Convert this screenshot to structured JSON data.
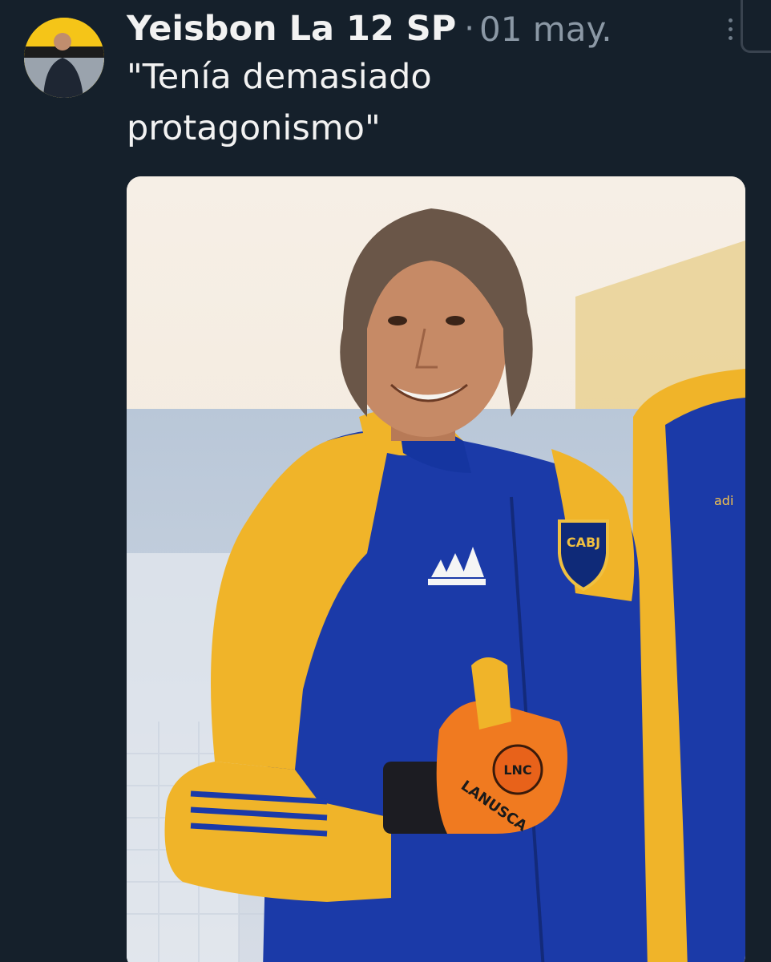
{
  "tweet": {
    "display_name": "Yeisbon La 12 SP",
    "separator": "·",
    "timestamp": "01 may.",
    "text": "\"Tenía demasiado protagonismo\"",
    "more_icon": "more-vertical-icon"
  },
  "photo": {
    "jacket_badge_text": "CABJ",
    "glove_text": "LANUSCA",
    "glove_logo_text": "LNC",
    "colors": {
      "jacket_blue": "#1b3aa8",
      "jacket_yellow": "#f0b429",
      "glove_orange": "#f07a20",
      "background": "#15202b"
    }
  }
}
